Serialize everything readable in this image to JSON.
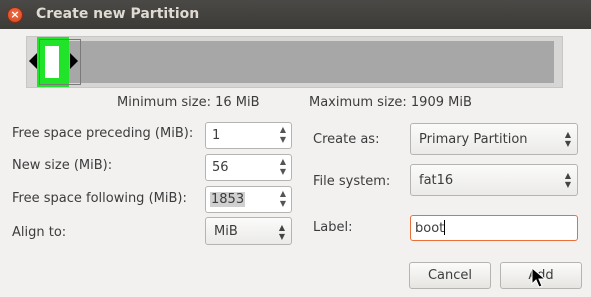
{
  "window": {
    "title": "Create new Partition"
  },
  "sizes": {
    "minimum": "Minimum size: 16 MiB",
    "maximum": "Maximum size: 1909 MiB"
  },
  "fields": {
    "free_preceding": {
      "label": "Free space preceding (MiB):",
      "value": "1"
    },
    "new_size": {
      "label": "New size (MiB):",
      "value": "56"
    },
    "free_following": {
      "label": "Free space following (MiB):",
      "value": "1853"
    },
    "align": {
      "label": "Align to:",
      "value": "MiB"
    },
    "create_as": {
      "label": "Create as:",
      "value": "Primary Partition"
    },
    "file_system": {
      "label": "File system:",
      "value": "fat16"
    },
    "partition_label": {
      "label": "Label:",
      "value": "boot"
    }
  },
  "buttons": {
    "cancel": "Cancel",
    "add": "Add"
  },
  "colors": {
    "partition_fill": "#21e32a",
    "unallocated": "#a7a7a7",
    "focus_border": "#e8703a"
  }
}
